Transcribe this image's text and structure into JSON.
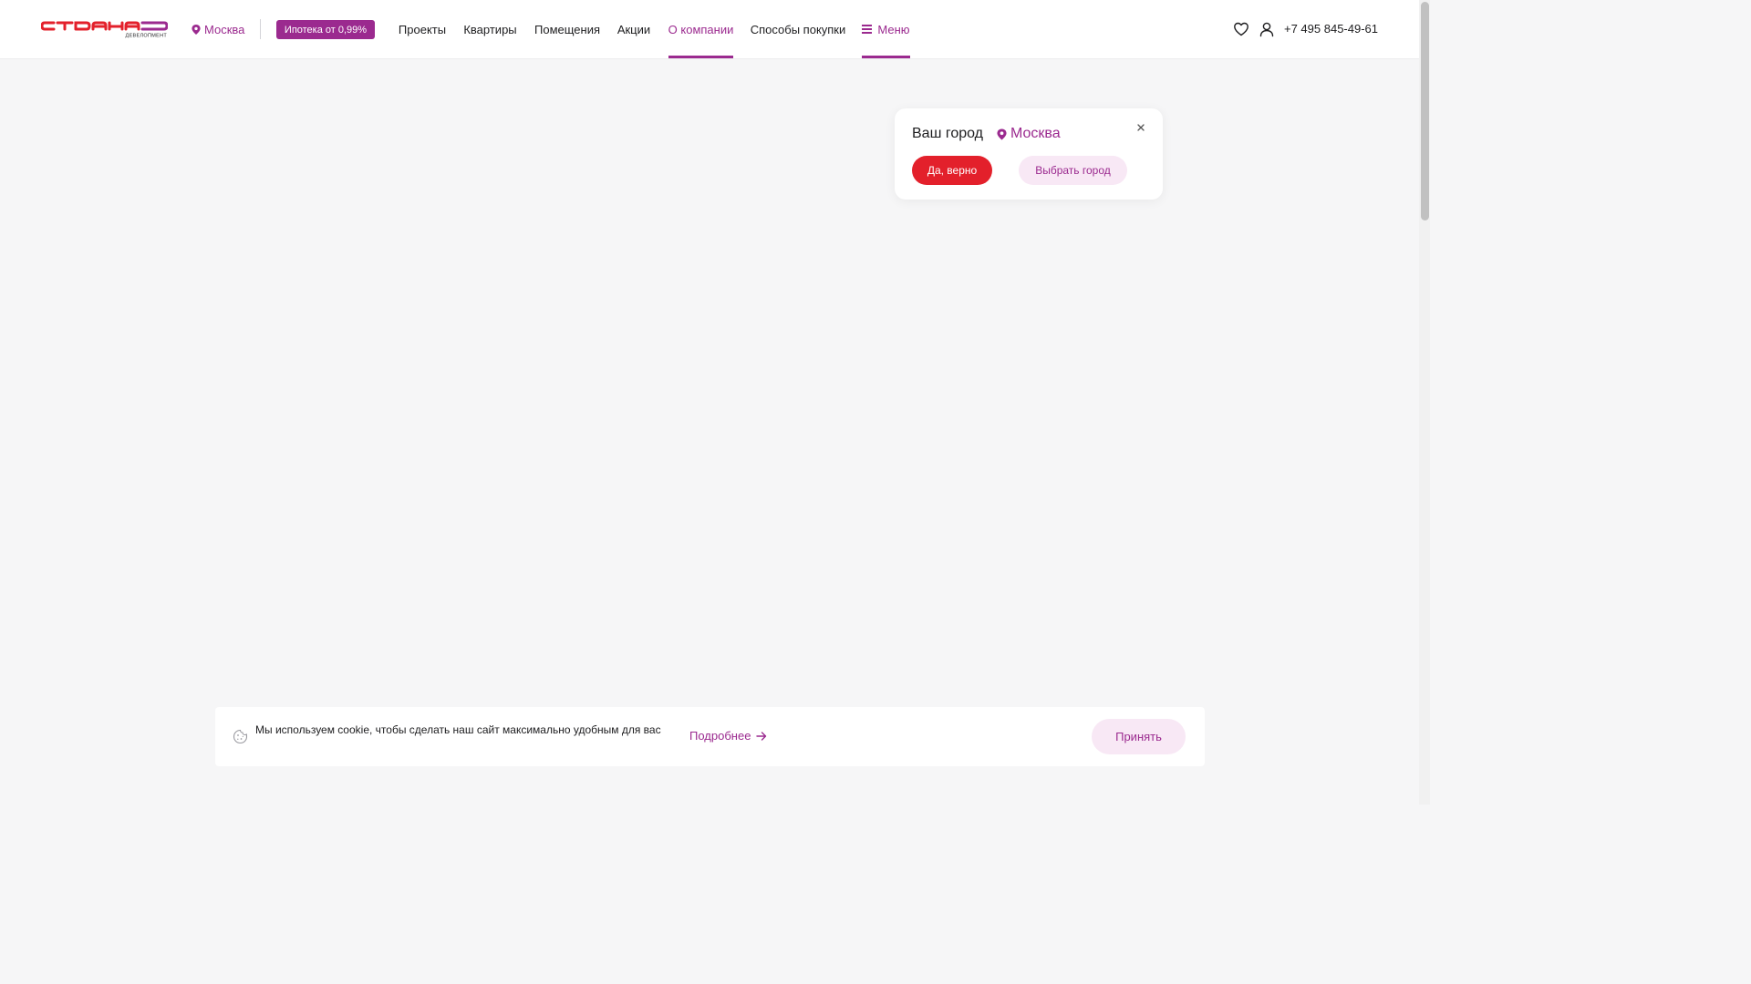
{
  "header": {
    "logo": {
      "name": "logo-strana-development",
      "wordmark": "СТРАНА",
      "subline": "ДЕВЕЛОПМЕНТ"
    },
    "city": "Москва",
    "mortgage_badge": "Ипотека от 0,99%",
    "nav": [
      {
        "label": "Проекты"
      },
      {
        "label": "Квартиры"
      },
      {
        "label": "Помещения"
      },
      {
        "label": "Акции"
      },
      {
        "label": "О компании",
        "active": true
      },
      {
        "label": "Способы покупки"
      }
    ],
    "menu_label": "Меню",
    "phone": "+7 495 845-49-61",
    "icons": [
      "heart-icon",
      "user-icon"
    ]
  },
  "city_popup": {
    "title": "Ваш город",
    "city": "Москва",
    "confirm_button": "Да, верно",
    "choose_button": "Выбрать город"
  },
  "cookie_banner": {
    "text": "Мы используем cookie, чтобы сделать наш сайт максимально удобным для вас",
    "more_link": "Подробнее",
    "accept_button": "Принять"
  },
  "colors": {
    "brand": "#9b2a8f",
    "accent_red": "#e3202b",
    "background": "#f6f6f7",
    "surface": "#ffffff",
    "soft_pink": "#f8e8f5"
  }
}
